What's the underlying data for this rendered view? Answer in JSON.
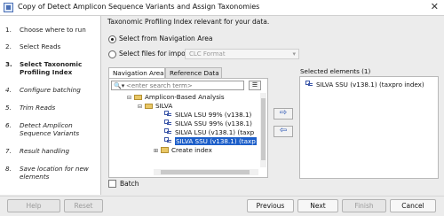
{
  "window": {
    "title": "Copy of Detect Amplicon Sequence Variants and Assign Taxonomies",
    "close_glyph": "✕"
  },
  "steps": [
    {
      "num": "1.",
      "label": "Choose where to run",
      "state": "done"
    },
    {
      "num": "2.",
      "label": "Select Reads",
      "state": "done"
    },
    {
      "num": "3.",
      "label": "Select Taxonomic Profiling Index",
      "state": "current"
    },
    {
      "num": "4.",
      "label": "Configure batching",
      "state": "future"
    },
    {
      "num": "5.",
      "label": "Trim Reads",
      "state": "future"
    },
    {
      "num": "6.",
      "label": "Detect Amplicon Sequence Variants",
      "state": "future"
    },
    {
      "num": "7.",
      "label": "Result handling",
      "state": "future"
    },
    {
      "num": "8.",
      "label": "Save location for new elements",
      "state": "future"
    }
  ],
  "main": {
    "instruction": "Taxonomic Profiling Index relevant for your data.",
    "radio_navigation": "Select from Navigation Area",
    "radio_files": "Select files for import:",
    "format_value": "CLC Format",
    "tabs": [
      "Navigation Area",
      "Reference Data"
    ],
    "search_placeholder": "<enter search term>",
    "tree": [
      {
        "label": "Amplicon-Based Analysis",
        "icon": "folder",
        "toggle": "⊟"
      },
      {
        "label": "SILVA",
        "icon": "folder",
        "toggle": "⊟"
      },
      {
        "label": "SILVA LSU 99% (v138.1)",
        "icon": "db"
      },
      {
        "label": "SILVA SSU 99% (v138.1)",
        "icon": "db"
      },
      {
        "label": "SILVA LSU (v138.1) (taxp",
        "icon": "db"
      },
      {
        "label": "SILVA SSU (v138.1) (taxp",
        "icon": "db",
        "selected": true
      },
      {
        "label": "Create index",
        "icon": "create",
        "toggle": "⊞"
      }
    ],
    "move_right": "⇨",
    "move_left": "⇦",
    "selected_title": "Selected elements (1)",
    "selected_items": [
      "SILVA SSU (v138.1) (taxpro index)"
    ],
    "batch_label": "Batch"
  },
  "footer": {
    "help": "Help",
    "reset": "Reset",
    "previous": "Previous",
    "next": "Next",
    "finish": "Finish",
    "cancel": "Cancel"
  }
}
